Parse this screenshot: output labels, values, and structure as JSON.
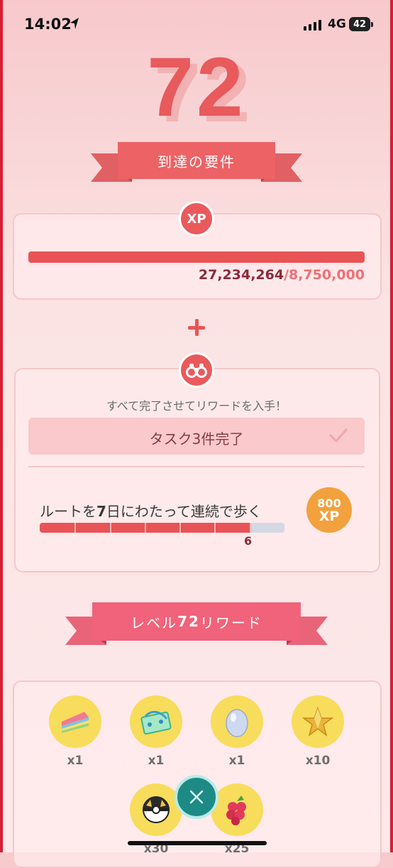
{
  "status_bar": {
    "time": "14:02",
    "network": "4G",
    "battery": "42",
    "icons": [
      "location-arrow-icon",
      "signal-bars-icon",
      "battery-icon"
    ]
  },
  "level": {
    "number": "72"
  },
  "requirements_ribbon": {
    "label": "到達の要件"
  },
  "xp_section": {
    "badge": "XP",
    "current": "27,234,264",
    "goal": "/8,750,000",
    "progress_fraction": 1.0
  },
  "tasks_section": {
    "icon": "binoculars-icon",
    "description": "すべて完了させてリワードを入手！",
    "completed_label": "タスク3件完了",
    "task": {
      "title_pre": "ルートを",
      "title_num": "7",
      "title_post": "日にわたって連続で歩く",
      "progress_value": "6",
      "progress_max": 7,
      "reward_amount": "800",
      "reward_unit": "XP"
    }
  },
  "rewards_ribbon": {
    "pre": "レベル",
    "num": "72",
    "post": "リワード"
  },
  "rewards": [
    {
      "icon": "rainbow-candy-icon",
      "count": "x1"
    },
    {
      "icon": "route-maker-icon",
      "count": "x1"
    },
    {
      "icon": "egg-icon",
      "count": "x1"
    },
    {
      "icon": "star-piece-icon",
      "count": "x10"
    },
    {
      "icon": "ultra-ball-icon",
      "count": "x30"
    },
    {
      "icon": "razz-berry-icon",
      "count": "x25"
    }
  ],
  "colors": {
    "accent_red": "#e85456",
    "frame_red": "#d81e35",
    "pink_ribbon": "#f0637a",
    "gold": "#f2a13c",
    "teal": "#1e8a85"
  }
}
